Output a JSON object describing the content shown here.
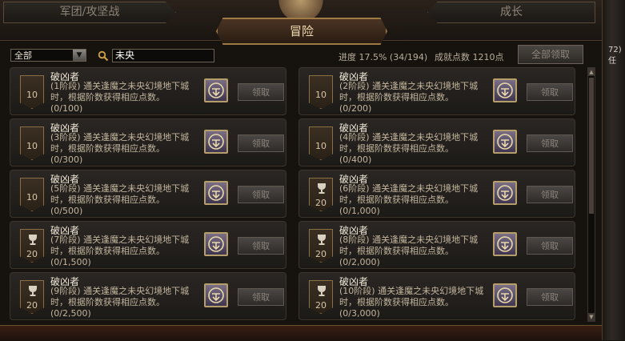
{
  "tabs": {
    "left": "军团/攻坚战",
    "right": "成长",
    "active": "冒险"
  },
  "filter": {
    "category": "全部",
    "search_value": "未央"
  },
  "stats": {
    "progress": "进度 17.5% (34/194)",
    "points": "成就点数 1210点",
    "claim_all": "全部领取"
  },
  "edge_text": "72)\n任",
  "items": [
    {
      "title": "破凶者",
      "desc": "(1阶段) 通关逢魔之未央幻境地下城时，根据阶数获得相应点数。",
      "progress": "(0/100)",
      "badge": "10",
      "badge_type": "plain",
      "claim": "领取"
    },
    {
      "title": "破凶者",
      "desc": "(2阶段) 通关逢魔之未央幻境地下城时，根据阶数获得相应点数。",
      "progress": "(0/200)",
      "badge": "10",
      "badge_type": "plain",
      "claim": "领取"
    },
    {
      "title": "破凶者",
      "desc": "(3阶段) 通关逢魔之未央幻境地下城时，根据阶数获得相应点数。",
      "progress": "(0/300)",
      "badge": "10",
      "badge_type": "plain",
      "claim": "领取"
    },
    {
      "title": "破凶者",
      "desc": "(4阶段) 通关逢魔之未央幻境地下城时，根据阶数获得相应点数。",
      "progress": "(0/400)",
      "badge": "10",
      "badge_type": "plain",
      "claim": "领取"
    },
    {
      "title": "破凶者",
      "desc": "(5阶段) 通关逢魔之未央幻境地下城时，根据阶数获得相应点数。",
      "progress": "(0/500)",
      "badge": "10",
      "badge_type": "plain",
      "claim": "领取"
    },
    {
      "title": "破凶者",
      "desc": "(6阶段) 通关逢魔之未央幻境地下城时，根据阶数获得相应点数。",
      "progress": "(0/1,000)",
      "badge": "20",
      "badge_type": "cup",
      "claim": "领取"
    },
    {
      "title": "破凶者",
      "desc": "(7阶段) 通关逢魔之未央幻境地下城时，根据阶数获得相应点数。",
      "progress": "(0/1,500)",
      "badge": "20",
      "badge_type": "cup",
      "claim": "领取"
    },
    {
      "title": "破凶者",
      "desc": "(8阶段) 通关逢魔之未央幻境地下城时，根据阶数获得相应点数。",
      "progress": "(0/2,000)",
      "badge": "20",
      "badge_type": "cup",
      "claim": "领取"
    },
    {
      "title": "破凶者",
      "desc": "(9阶段) 通关逢魔之未央幻境地下城时，根据阶数获得相应点数。",
      "progress": "(0/2,500)",
      "badge": "20",
      "badge_type": "cup",
      "claim": "领取"
    },
    {
      "title": "破凶者",
      "desc": "(10阶段) 通关逢魔之未央幻境地下城时，根据阶数获得相应点数。",
      "progress": "(0/3,000)",
      "badge": "20",
      "badge_type": "cup",
      "claim": "领取"
    }
  ]
}
